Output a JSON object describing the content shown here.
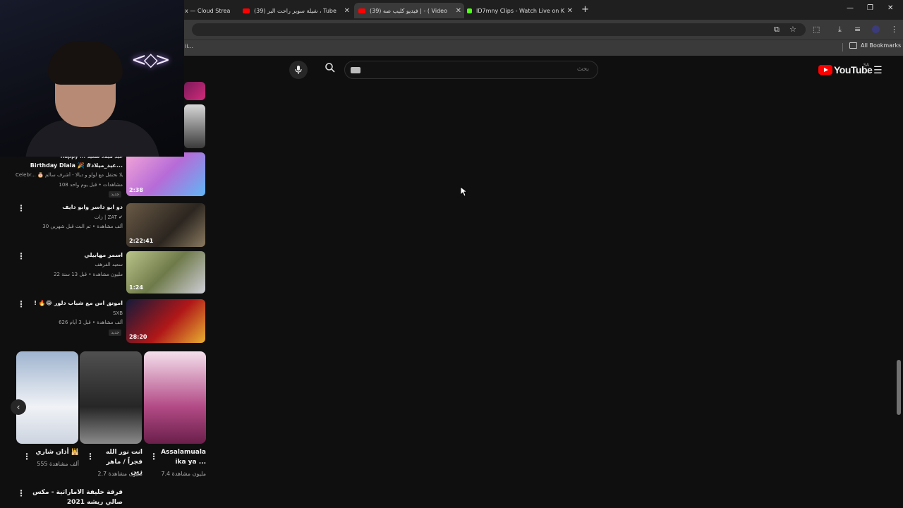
{
  "browser": {
    "tabs": [
      {
        "title": "x — Cloud Strea",
        "color": "#6b6b6b"
      },
      {
        "title": "(39) شيلة سوير راحت البر ، Tube",
        "color": "#ff0000"
      },
      {
        "title": "(39) فيديو كليب صه | - ( Video",
        "color": "#ff0000"
      },
      {
        "title": "ID7mny Clips - Watch Live on K",
        "color": "#53fc18"
      }
    ],
    "new_tab": "+",
    "window_controls": {
      "minimize": "—",
      "restore": "❐",
      "close": "✕"
    },
    "bookmarks_label": "All Bookmarks",
    "bookmark_stub": "ii..."
  },
  "youtube": {
    "logo_text": "YouTube",
    "country": "SA",
    "search_placeholder": "بحث",
    "menu_icon": "☰"
  },
  "list_rows": [
    {
      "title": "Birthday Diala 🎉 #عيد_ميلاد...",
      "title_top": "Happy ... عيد ميلاد سعيد",
      "meta1": "Celebr... 🎂 يلا نحتفل مع لولو و ديالا - أشرف سالم",
      "meta2": "108 مشاهدات • قبل يوم واحد",
      "badge": "جديد",
      "duration": "2:38"
    },
    {
      "title": "دو ابو داسر وابو دايف",
      "meta1": "زات | ZAT ✔",
      "meta2": "30 ألف مشاهدة • تم البث قبل شهرين",
      "badge": "",
      "duration": "2:22:41"
    },
    {
      "title": "اسمر مهابيلي",
      "meta1": "سعيد الفرهف",
      "meta2": "22 مليون مشاهدة • قبل 13 سنة",
      "badge": "",
      "duration": "1:24"
    },
    {
      "title": "! 🔥😂 امونق اس مع شباب دلور",
      "meta1": "SXB",
      "meta2": "626 ألف مشاهدة • قبل 3 أيام",
      "badge": "جديد",
      "duration": "28:20"
    }
  ],
  "shorts": [
    {
      "title": "أذان شاري 🕌",
      "views": "555 ألف مشاهدة"
    },
    {
      "title": "انت نور الله فجراً / ماهر زين",
      "views": "2.7 مليون مشاهدة"
    },
    {
      "title": "Assalamuala ika ya ...",
      "views": "7.4 مليون مشاهدة"
    }
  ],
  "bottom_row": {
    "title": "فرقة خليفة الاماراتية - مكس صالي ريشه 2021"
  },
  "webcam": {
    "logo": "<◇>"
  },
  "colors": {
    "background": "#0f0f0f",
    "accent": "#ff0000",
    "kick": "#53fc18"
  }
}
